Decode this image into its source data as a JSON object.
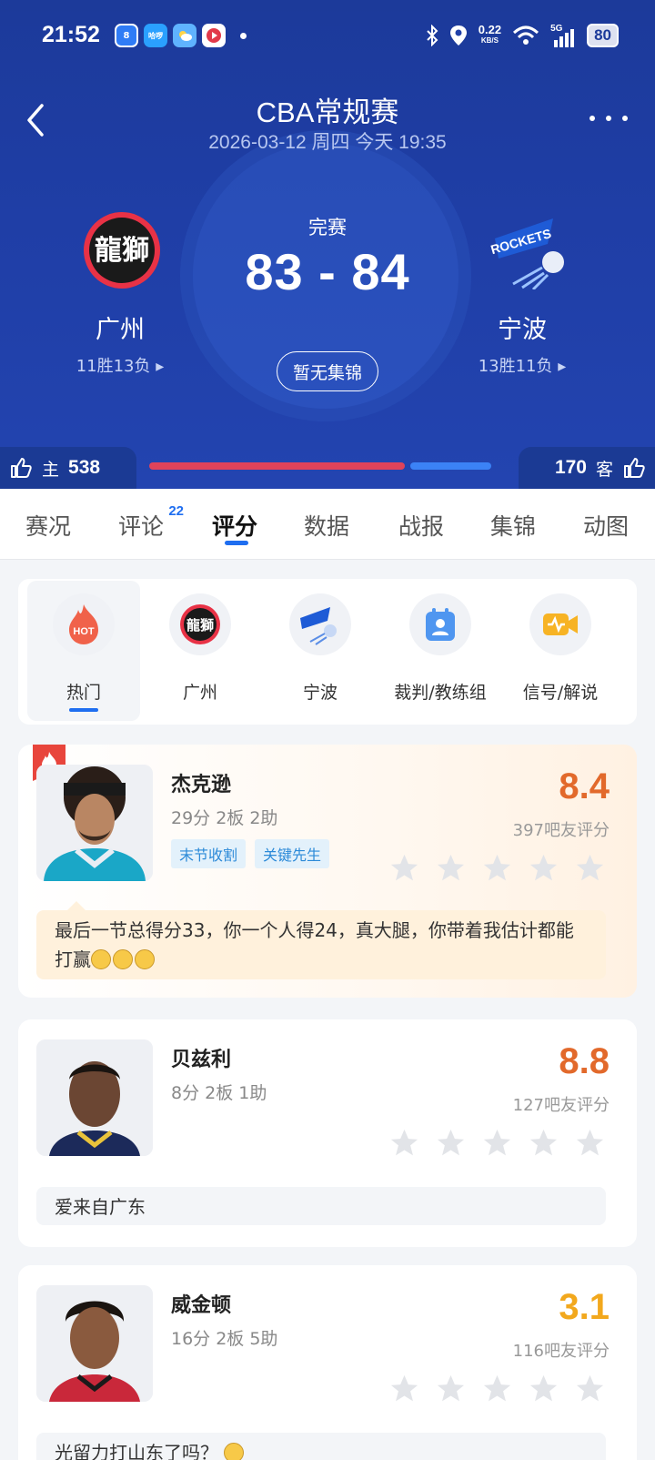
{
  "status_bar": {
    "time": "21:52",
    "apps": [
      "8",
      "哈啰",
      "",
      ""
    ],
    "net_speed": "0.22",
    "net_unit": "KB/S",
    "signal": "5G",
    "battery": "80"
  },
  "header": {
    "title": "CBA常规赛",
    "date": "2026-03-12 周四 今天 19:35",
    "game_status": "完赛",
    "score": "83 - 84",
    "highlights_button": "暂无集锦",
    "home": {
      "name": "广州",
      "record": "11胜13负",
      "logo_text": "龍獅"
    },
    "away": {
      "name": "宁波",
      "record": "13胜11负",
      "logo_text": "ROCKETS"
    },
    "likes": {
      "home_label": "主",
      "home_count": "538",
      "away_label": "客",
      "away_count": "170"
    },
    "vote_share": {
      "home": 0.76,
      "away": 0.24
    },
    "colors": {
      "home_bar": "#e0435a",
      "away_bar": "#3b82f6",
      "bg": "#1f3ea6"
    }
  },
  "tabs": [
    {
      "label": "赛况"
    },
    {
      "label": "评论",
      "badge": "22"
    },
    {
      "label": "评分",
      "active": true
    },
    {
      "label": "数据"
    },
    {
      "label": "战报"
    },
    {
      "label": "集锦"
    },
    {
      "label": "动图"
    }
  ],
  "filters": [
    {
      "label": "热门",
      "icon": "hot-icon",
      "icon_text": "HOT",
      "active": true
    },
    {
      "label": "广州",
      "icon": "guangzhou-logo-icon"
    },
    {
      "label": "宁波",
      "icon": "ningbo-logo-icon"
    },
    {
      "label": "裁判/教练组",
      "icon": "referee-icon"
    },
    {
      "label": "信号/解说",
      "icon": "broadcast-icon"
    }
  ],
  "players": [
    {
      "name": "杰克逊",
      "stats": "29分 2板 2助",
      "tags": [
        "末节收割",
        "关键先生"
      ],
      "rating": "8.4",
      "rating_count": "397吧友评分",
      "rating_color": "#e2692b",
      "comment": "最后一节总得分33，你一个人得24，真大腿，你带着我估计都能打赢",
      "comment_emoji_count": 3,
      "hot": true,
      "jersey": "#1aa7c7"
    },
    {
      "name": "贝兹利",
      "stats": "8分 2板 1助",
      "tags": [],
      "rating": "8.8",
      "rating_count": "127吧友评分",
      "rating_color": "#e2692b",
      "comment": "爱来自广东",
      "comment_emoji_count": 0,
      "hot": false,
      "jersey": "#1c2a5a"
    },
    {
      "name": "威金顿",
      "stats": "16分 2板 5助",
      "tags": [],
      "rating": "3.1",
      "rating_count": "116吧友评分",
      "rating_color": "#f2a81d",
      "comment": "光留力打山东了吗？",
      "comment_emoji_count": 1,
      "hot": false,
      "jersey": "#c9283a"
    }
  ]
}
